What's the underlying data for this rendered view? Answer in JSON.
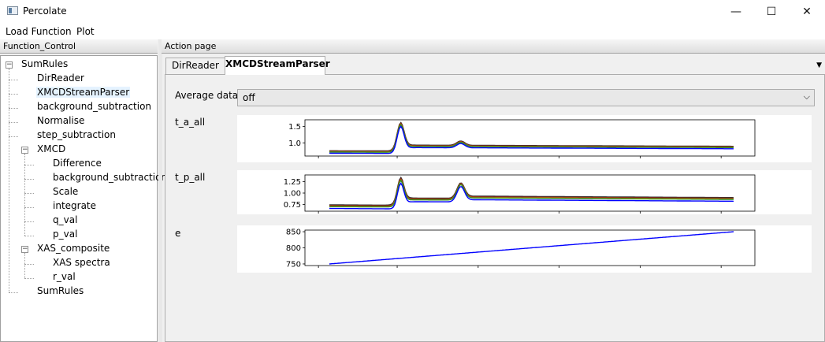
{
  "window": {
    "title": "Percolate",
    "minimize": "—",
    "maximize": "☐",
    "close": "✕"
  },
  "menu": [
    "Load Function",
    "Plot"
  ],
  "left_panel": {
    "header": "Function_Control",
    "tree": [
      {
        "label": "SumRules",
        "level": 0,
        "expanded": true
      },
      {
        "label": "DirReader",
        "level": 1
      },
      {
        "label": "XMCDStreamParser",
        "level": 1,
        "selected": true
      },
      {
        "label": "background_subtraction",
        "level": 1
      },
      {
        "label": "Normalise",
        "level": 1
      },
      {
        "label": "step_subtraction",
        "level": 1
      },
      {
        "label": "XMCD",
        "level": 1,
        "expanded": true
      },
      {
        "label": "Difference",
        "level": 2
      },
      {
        "label": "background_subtraction",
        "level": 2
      },
      {
        "label": "Scale",
        "level": 2
      },
      {
        "label": "integrate",
        "level": 2
      },
      {
        "label": "q_val",
        "level": 2
      },
      {
        "label": "p_val",
        "level": 2
      },
      {
        "label": "XAS_composite",
        "level": 1,
        "expanded": true
      },
      {
        "label": "XAS spectra",
        "level": 2
      },
      {
        "label": "r_val",
        "level": 2
      },
      {
        "label": "SumRules",
        "level": 1
      }
    ]
  },
  "right_panel": {
    "header": "Action page",
    "tabs": [
      "DirReader",
      "XMCDStreamParser"
    ],
    "active_tab": 1,
    "average_label": "Average data",
    "average_value": "off"
  },
  "chart_data": [
    {
      "type": "line",
      "label": "t_a_all",
      "yticks": [
        "1.5",
        "1.0"
      ],
      "ylim": [
        0.6,
        1.7
      ],
      "colors": [
        "#333333",
        "#8b1a1a",
        "#c07000",
        "#2a8a2a",
        "#0000ff"
      ],
      "series_shape": "absorption edge: flat ~0.7, sharp peak ~1.6 near 17%, small peak ~1.05 near 32%, tail ~0.9"
    },
    {
      "type": "line",
      "label": "t_p_all",
      "yticks": [
        "1.25",
        "1.00",
        "0.75"
      ],
      "ylim": [
        0.6,
        1.4
      ],
      "colors": [
        "#333333",
        "#8b1a1a",
        "#c07000",
        "#2a8a2a",
        "#0000ff"
      ],
      "series_shape": "two peaks ~1.3 near 17% and ~1.15 near 32%, tail ~0.85"
    },
    {
      "type": "line",
      "label": "e",
      "yticks": [
        "850",
        "800",
        "750"
      ],
      "ylim": [
        745,
        855
      ],
      "x": [
        0,
        1
      ],
      "y": [
        750,
        850
      ],
      "colors": [
        "#0000ff"
      ]
    }
  ]
}
